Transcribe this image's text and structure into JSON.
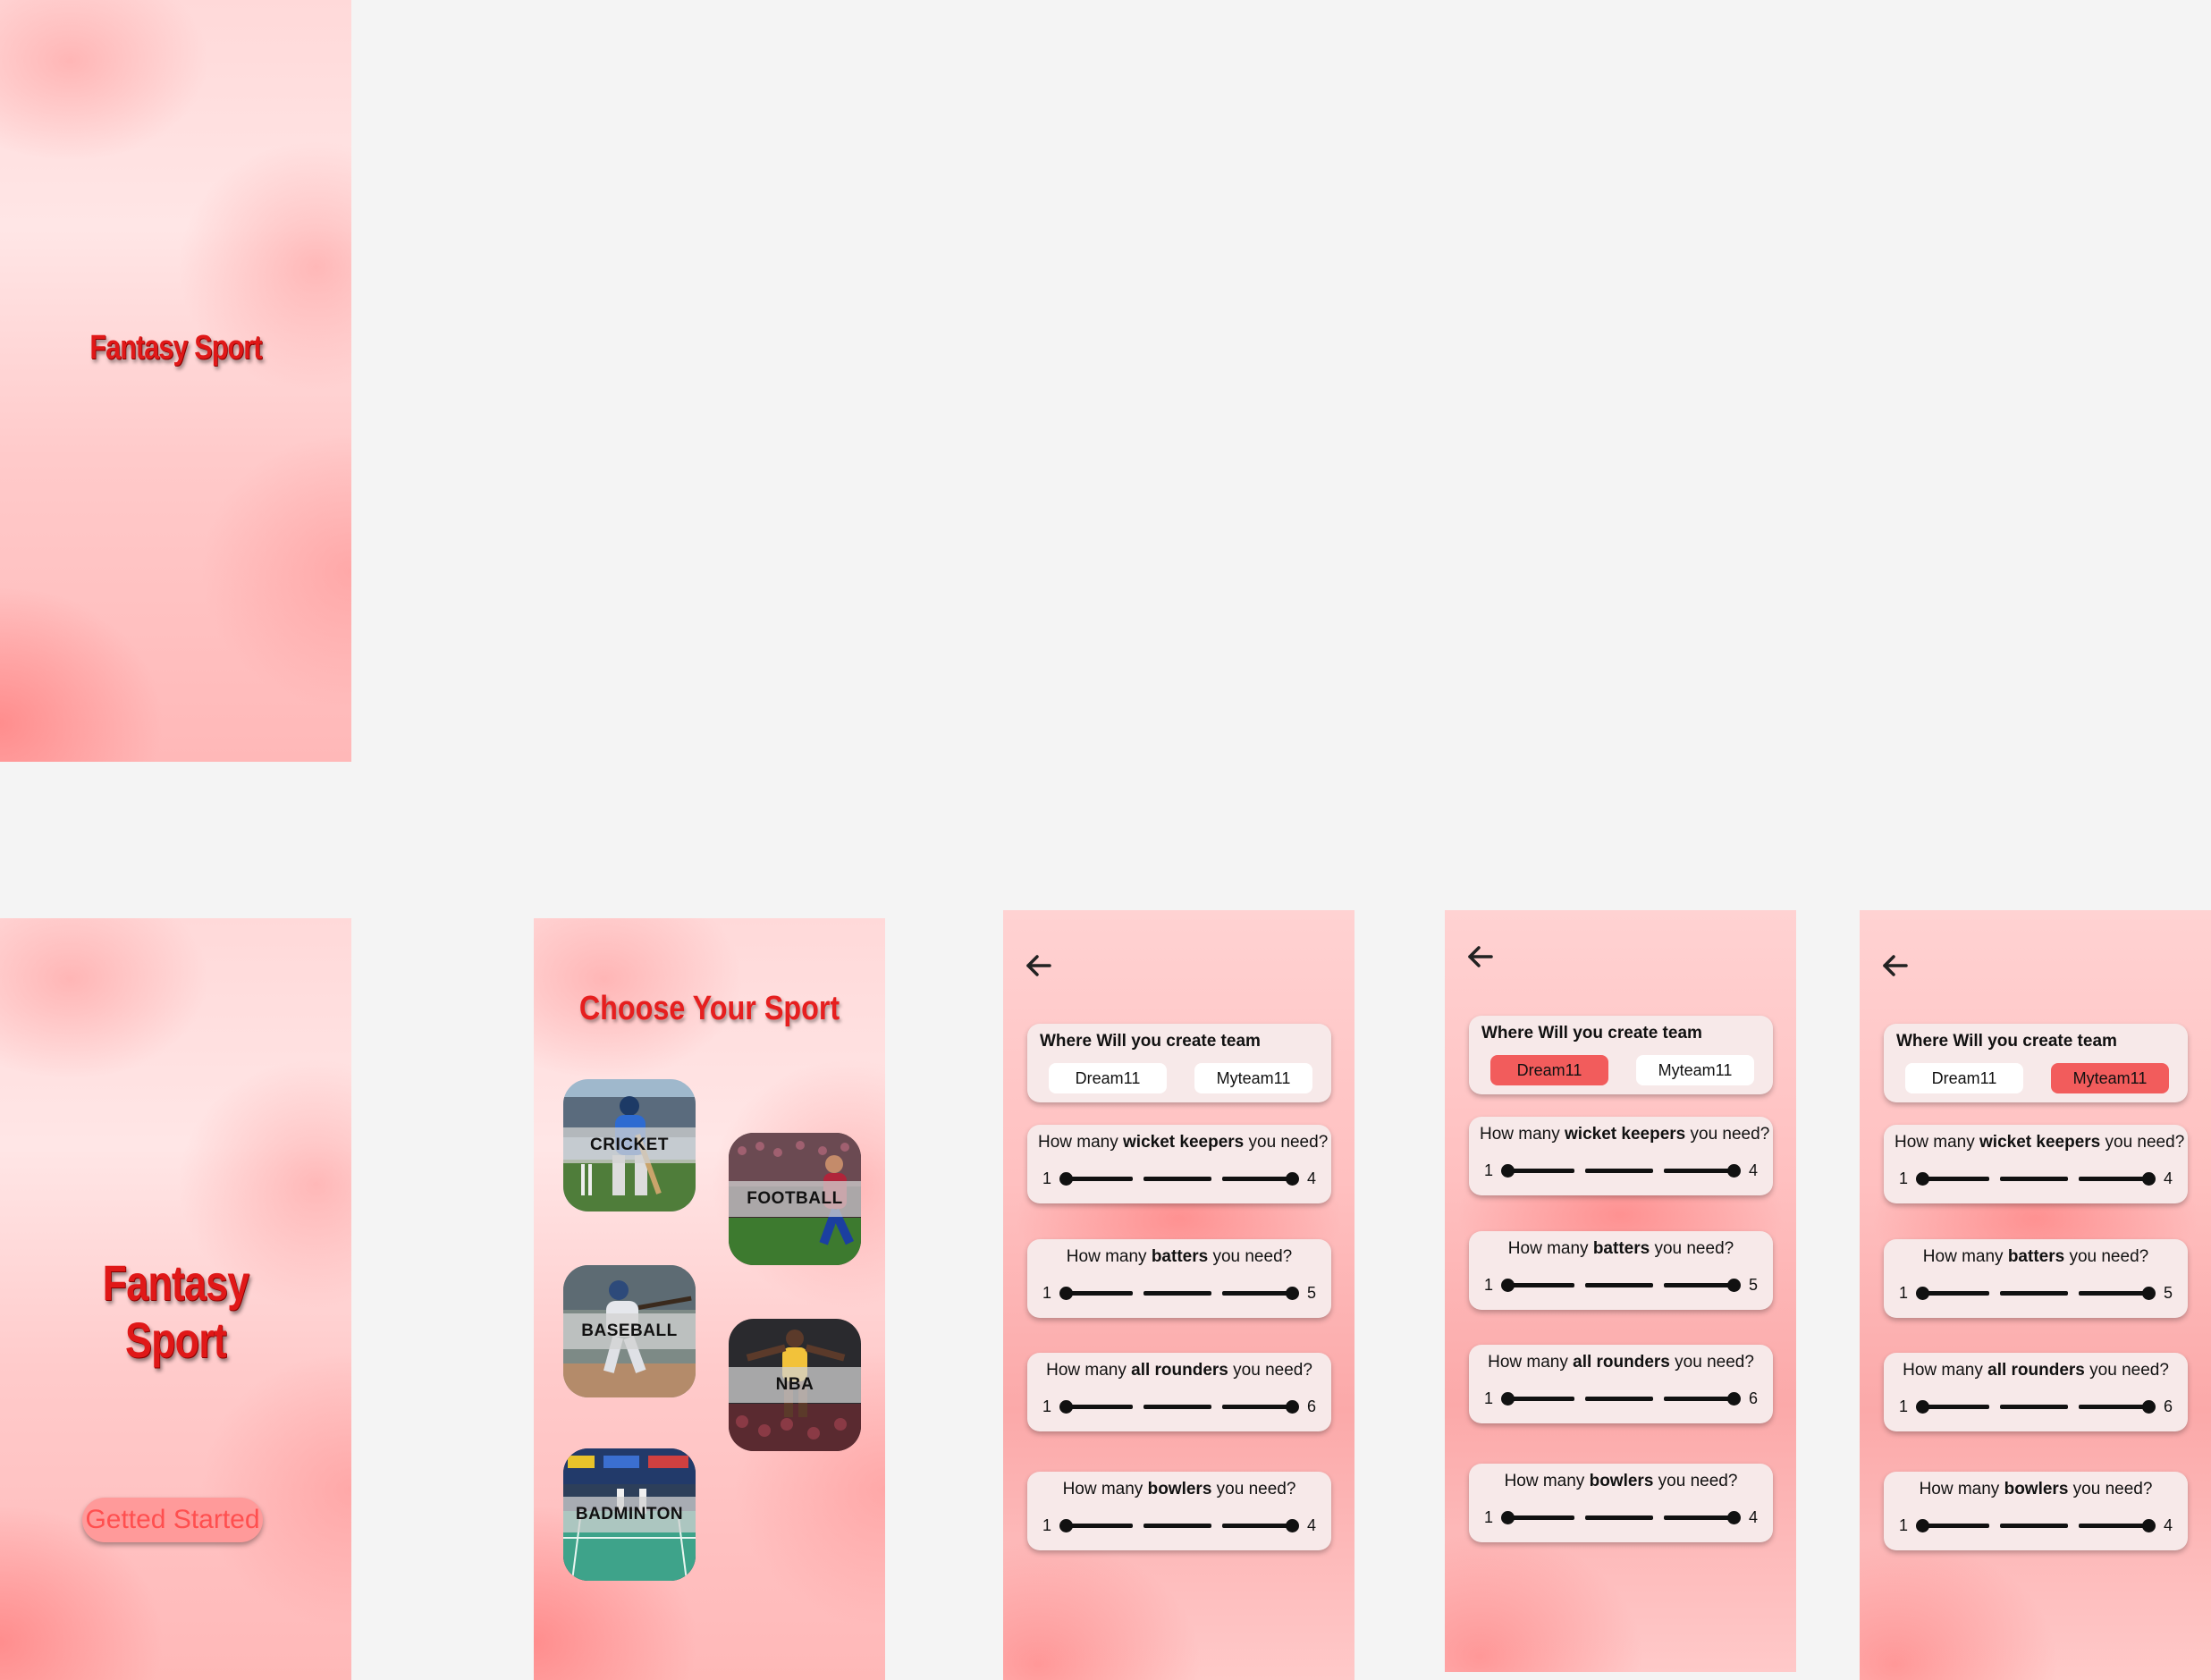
{
  "brand": {
    "name": "Fantasy Sport",
    "name_line1": "Fantasy",
    "name_line2": "Sport",
    "accent": "#e01818"
  },
  "onboarding": {
    "cta_label": "Getted Started",
    "cta_color": "#ff9a9a"
  },
  "sport_selection": {
    "title": "Choose Your Sport",
    "sports": [
      {
        "label": "CRICKET"
      },
      {
        "label": "FOOTBALL"
      },
      {
        "label": "BASEBALL"
      },
      {
        "label": "NBA"
      },
      {
        "label": "BADMINTON"
      }
    ]
  },
  "team_setup": {
    "back_icon": "arrow-left-icon",
    "platform_question": "Where Will you create team",
    "platforms": [
      "Dream11",
      "Myteam11"
    ],
    "active_color": "#f25c5c",
    "screens": [
      {
        "selected_platform": "none"
      },
      {
        "selected_platform": "Dream11"
      },
      {
        "selected_platform": "Myteam11"
      }
    ],
    "questions": [
      {
        "prefix": "How many ",
        "bold": "wicket keepers",
        "suffix": " you need?",
        "min": "1",
        "max": "4"
      },
      {
        "prefix": "How many ",
        "bold": "batters",
        "suffix": " you need?",
        "min": "1",
        "max": "5"
      },
      {
        "prefix": "How many ",
        "bold": "all rounders",
        "suffix": " you need?",
        "min": "1",
        "max": "6"
      },
      {
        "prefix": "How many ",
        "bold": "bowlers",
        "suffix": " you need?",
        "min": "1",
        "max": "4"
      }
    ]
  }
}
